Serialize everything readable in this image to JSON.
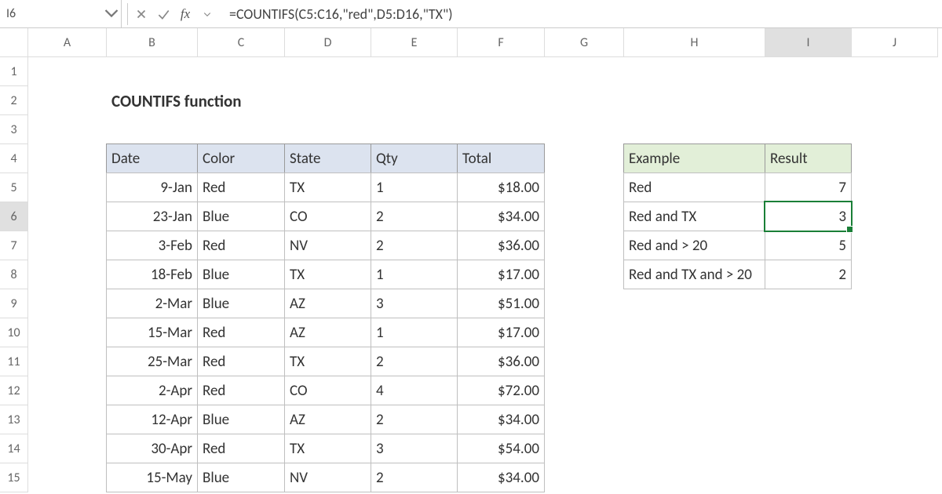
{
  "formula_bar": {
    "name_box": "I6",
    "formula": "=COUNTIFS(C5:C16,\"red\",D5:D16,\"TX\")"
  },
  "columns": [
    "A",
    "B",
    "C",
    "D",
    "E",
    "F",
    "G",
    "H",
    "I",
    "J"
  ],
  "rows": [
    "1",
    "2",
    "3",
    "4",
    "5",
    "6",
    "7",
    "8",
    "9",
    "10",
    "11",
    "12",
    "13",
    "14",
    "15"
  ],
  "page_title": "COUNTIFS function",
  "main_table": {
    "headers": [
      "Date",
      "Color",
      "State",
      "Qty",
      "Total"
    ],
    "rows": [
      {
        "date": "9-Jan",
        "color": "Red",
        "state": "TX",
        "qty": "1",
        "total": "$18.00"
      },
      {
        "date": "23-Jan",
        "color": "Blue",
        "state": "CO",
        "qty": "2",
        "total": "$34.00"
      },
      {
        "date": "3-Feb",
        "color": "Red",
        "state": "NV",
        "qty": "2",
        "total": "$36.00"
      },
      {
        "date": "18-Feb",
        "color": "Blue",
        "state": "TX",
        "qty": "1",
        "total": "$17.00"
      },
      {
        "date": "2-Mar",
        "color": "Blue",
        "state": "AZ",
        "qty": "3",
        "total": "$51.00"
      },
      {
        "date": "15-Mar",
        "color": "Red",
        "state": "AZ",
        "qty": "1",
        "total": "$17.00"
      },
      {
        "date": "25-Mar",
        "color": "Red",
        "state": "TX",
        "qty": "2",
        "total": "$36.00"
      },
      {
        "date": "2-Apr",
        "color": "Red",
        "state": "CO",
        "qty": "4",
        "total": "$72.00"
      },
      {
        "date": "12-Apr",
        "color": "Blue",
        "state": "AZ",
        "qty": "2",
        "total": "$34.00"
      },
      {
        "date": "30-Apr",
        "color": "Red",
        "state": "TX",
        "qty": "3",
        "total": "$54.00"
      },
      {
        "date": "15-May",
        "color": "Blue",
        "state": "NV",
        "qty": "2",
        "total": "$34.00"
      }
    ]
  },
  "result_table": {
    "headers": [
      "Example",
      "Result"
    ],
    "rows": [
      {
        "example": "Red",
        "result": "7"
      },
      {
        "example": "Red and TX",
        "result": "3"
      },
      {
        "example": "Red and > 20",
        "result": "5"
      },
      {
        "example": "Red and TX and > 20",
        "result": "2"
      }
    ]
  },
  "active": {
    "row": 6,
    "col": "I"
  }
}
